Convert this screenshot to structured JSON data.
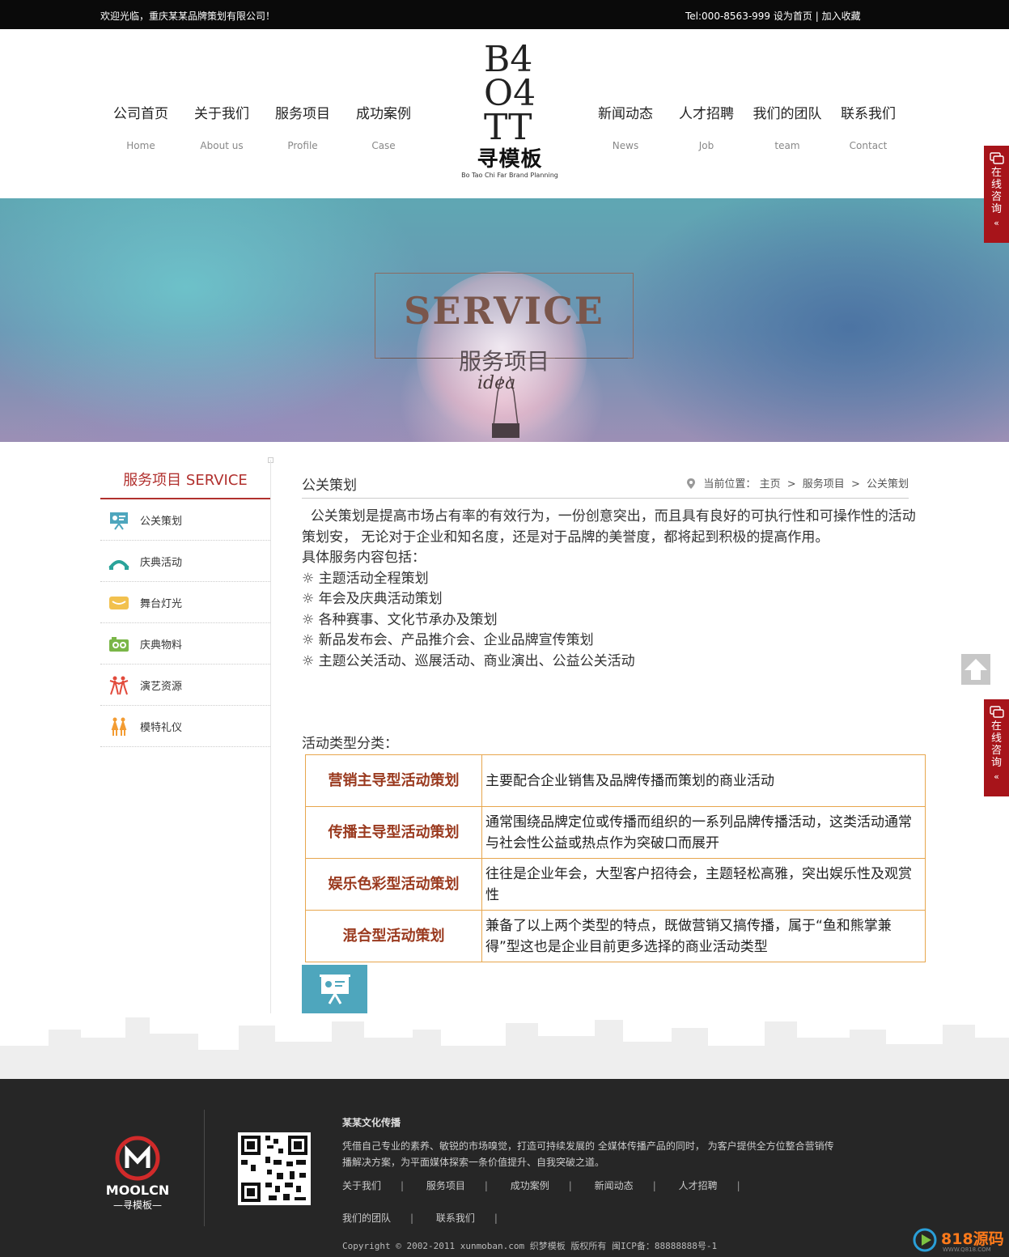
{
  "topbar": {
    "welcome": "欢迎光临，重庆某某品牌策划有限公司！",
    "tel": "Tel:000-8563-999",
    "set_home": "设为首页",
    "divider": "|",
    "add_fav": "加入收藏"
  },
  "nav": {
    "left": [
      {
        "cn": "公司首页",
        "en": "Home"
      },
      {
        "cn": "关于我们",
        "en": "About us"
      },
      {
        "cn": "服务项目",
        "en": "Profile"
      },
      {
        "cn": "成功案例",
        "en": "Case"
      }
    ],
    "right": [
      {
        "cn": "新闻动态",
        "en": "News"
      },
      {
        "cn": "人才招聘",
        "en": "Job"
      },
      {
        "cn": "我们的团队",
        "en": "team"
      },
      {
        "cn": "联系我们",
        "en": "Contact"
      }
    ]
  },
  "logo": {
    "mark_lines": [
      "B4",
      "O4",
      "TT"
    ],
    "cn": "寻模板",
    "en": "Bo Tao Chi Far Brand Planning"
  },
  "banner": {
    "en_title": "SERVICE",
    "cn_title": "服务项目",
    "script": "idea"
  },
  "consult": {
    "label": "在线咨询",
    "arrow": "«"
  },
  "sidebar": {
    "title": "服务项目 SERVICE",
    "items": [
      {
        "label": "公关策划",
        "icon": "presentation-icon"
      },
      {
        "label": "庆典活动",
        "icon": "arch-icon"
      },
      {
        "label": "舞台灯光",
        "icon": "stage-box-icon"
      },
      {
        "label": "庆典物料",
        "icon": "camera-icon"
      },
      {
        "label": "演艺资源",
        "icon": "dancers-icon"
      },
      {
        "label": "模特礼仪",
        "icon": "models-icon"
      }
    ]
  },
  "main": {
    "title": "公关策划",
    "breadcrumb": {
      "prefix": "当前位置：",
      "home": "主页",
      "sep": ">",
      "level1": "服务项目",
      "level2": "公关策划"
    },
    "intro": "  公关策划是提高市场占有率的有效行为，一份创意突出，而且具有良好的可执行性和可操作性的活动策划安， 无论对于企业和知名度，还是对于品牌的美誉度，都将起到积极的提高作用。",
    "services_label": "具体服务内容包括：",
    "services": [
      "☼ 主题活动全程策划",
      "☼ 年会及庆典活动策划",
      "☼ 各种赛事、文化节承办及策划",
      "☼ 新品发布会、产品推介会、企业品牌宣传策划",
      "☼ 主题公关活动、巡展活动、商业演出、公益公关活动"
    ],
    "types_label": "活动类型分类：",
    "types": [
      {
        "name": "营销主导型活动策划",
        "desc": "主要配合企业销售及品牌传播而策划的商业活动"
      },
      {
        "name": "传播主导型活动策划",
        "desc": "通常围绕品牌定位或传播而组织的一系列品牌传播活动，这类活动通常与社会性公益或热点作为突破口而展开"
      },
      {
        "name": "娱乐色彩型活动策划",
        "desc": "往往是企业年会，大型客户招待会，主题轻松高雅，突出娱乐性及观赏性"
      },
      {
        "name": "混合型活动策划",
        "desc": "兼备了以上两个类型的特点，既做营销又搞传播，属于“鱼和熊掌兼得”型这也是企业目前更多选择的商业活动类型"
      }
    ]
  },
  "footer": {
    "logo_text": "MOOLCN",
    "logo_sub": "—寻模板—",
    "company": "某某文化传播",
    "desc": "凭借自己专业的素养、敏锐的市场嗅觉，打造可持续发展的 全媒体传播产品的同时， 为客户提供全方位整合营销传播解决方案，为平面媒体探索一条价值提升、自我突破之道。",
    "links": [
      "关于我们",
      "服务项目",
      "成功案例",
      "新闻动态",
      "人才招聘"
    ],
    "links2": [
      "我们的团队",
      "联系我们"
    ],
    "bar": "|",
    "copyright": "Copyright © 2002-2011 xunmoban.com 织梦模板 版权所有 闽ICP备：88888888号-1"
  },
  "watermark": {
    "text": "818源码",
    "sub": "WWW.Q818.COM"
  },
  "colors": {
    "accent_red": "#b1302e",
    "consult_red": "#a7141a",
    "table_border": "#e7a64d",
    "type_name": "#9a3a1f",
    "tile_blue": "#4ea6bd",
    "footer_bg": "#262626"
  }
}
